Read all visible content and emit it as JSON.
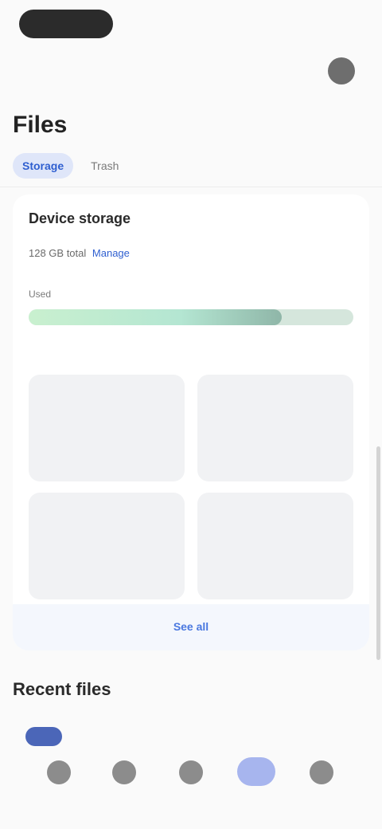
{
  "status_bar": {
    "right_text": ""
  },
  "page": {
    "title": "Files"
  },
  "tabs": [
    {
      "label": "Storage",
      "active": true
    },
    {
      "label": "Trash",
      "active": false
    }
  ],
  "storage_card": {
    "title": "Device storage",
    "title_suffix": "",
    "plan_text": "128 GB total",
    "plan_link": "Manage",
    "plan_sub": "",
    "used_label": "Used",
    "used_fraction": 0.78,
    "bar_left_text": "",
    "bar_right_text": "",
    "tiles": [
      {
        "value": "",
        "label": ""
      },
      {
        "value": "",
        "label": ""
      },
      {
        "value": "",
        "label": ""
      },
      {
        "value": "",
        "label": ""
      }
    ],
    "more_link": "See all"
  },
  "section": {
    "title": "Recent files"
  },
  "nav": {
    "items": [
      {
        "label": "",
        "icon": "home-icon",
        "active": false
      },
      {
        "label": "",
        "icon": "folder-icon",
        "active": false
      },
      {
        "label": "",
        "icon": "share-icon",
        "active": false
      },
      {
        "label": "",
        "icon": "storage-icon",
        "active": true
      },
      {
        "label": "",
        "icon": "settings-icon",
        "active": false
      }
    ]
  },
  "colors": {
    "accent": "#2f5fd0",
    "bar_fill": "#b4e6d2",
    "bar_track": "#d5e6dc",
    "nav_active": "#a7b5ee"
  }
}
